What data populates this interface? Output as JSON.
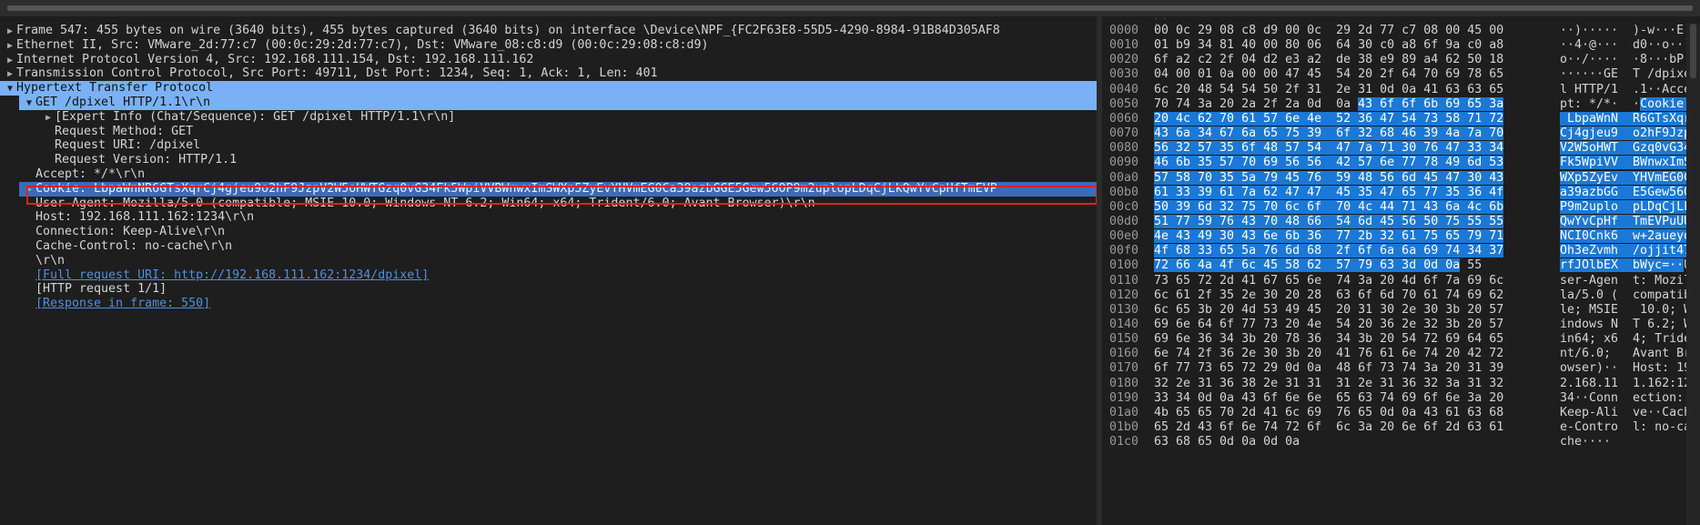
{
  "tree_rows": [
    {
      "text": "Frame 547: 455 bytes on wire (3640 bits), 455 bytes captured (3640 bits) on interface \\Device\\NPF_{FC2F63E8-55D5-4290-8984-91B84D305AF8",
      "indent": 0,
      "caret": "▶",
      "sel": "",
      "link": false
    },
    {
      "text": "Ethernet II, Src: VMware_2d:77:c7 (00:0c:29:2d:77:c7), Dst: VMware_08:c8:d9 (00:0c:29:08:c8:d9)",
      "indent": 0,
      "caret": "▶",
      "sel": "",
      "link": false
    },
    {
      "text": "Internet Protocol Version 4, Src: 192.168.111.154, Dst: 192.168.111.162",
      "indent": 0,
      "caret": "▶",
      "sel": "",
      "link": false
    },
    {
      "text": "Transmission Control Protocol, Src Port: 49711, Dst Port: 1234, Seq: 1, Ack: 1, Len: 401",
      "indent": 0,
      "caret": "▶",
      "sel": "",
      "link": false
    },
    {
      "text": "Hypertext Transfer Protocol",
      "indent": 0,
      "caret": "▼",
      "sel": "sel",
      "link": false
    },
    {
      "text": "GET /dpixel HTTP/1.1\\r\\n",
      "indent": 1,
      "caret": "▼",
      "sel": "sel",
      "link": false
    },
    {
      "text": "[Expert Info (Chat/Sequence): GET /dpixel HTTP/1.1\\r\\n]",
      "indent": 2,
      "caret": "▶",
      "sel": "",
      "link": false
    },
    {
      "text": "Request Method: GET",
      "indent": 2,
      "caret": "",
      "sel": "",
      "link": false
    },
    {
      "text": "Request URI: /dpixel",
      "indent": 2,
      "caret": "",
      "sel": "",
      "link": false
    },
    {
      "text": "Request Version: HTTP/1.1",
      "indent": 2,
      "caret": "",
      "sel": "",
      "link": false
    },
    {
      "text": "Accept: */*\\r\\n",
      "indent": 1,
      "caret": "",
      "sel": "",
      "link": false
    },
    {
      "text": "Cookie: LbpaWnNR6GTsXqrCj4gjeu9o2hF9JzpV2W5oHWTGzq0vG34Fk5WpiVVBWnwxImSWXp5ZyEvYHVmEG0Ca39azbGGE5Gew56OP9m2uplopLDqCjLkQwYvCpHfTmEVP",
      "indent": 1,
      "caret": "▶",
      "sel": "sel2",
      "link": false
    },
    {
      "text": "User-Agent: Mozilla/5.0 (compatible; MSIE 10.0; Windows NT 6.2; Win64; x64; Trident/6.0; Avant Browser)\\r\\n",
      "indent": 1,
      "caret": "",
      "sel": "",
      "link": false
    },
    {
      "text": "Host: 192.168.111.162:1234\\r\\n",
      "indent": 1,
      "caret": "",
      "sel": "",
      "link": false
    },
    {
      "text": "Connection: Keep-Alive\\r\\n",
      "indent": 1,
      "caret": "",
      "sel": "",
      "link": false
    },
    {
      "text": "Cache-Control: no-cache\\r\\n",
      "indent": 1,
      "caret": "",
      "sel": "",
      "link": false
    },
    {
      "text": "\\r\\n",
      "indent": 1,
      "caret": "",
      "sel": "",
      "link": false
    },
    {
      "text": "[Full request URI: http://192.168.111.162:1234/dpixel]",
      "indent": 1,
      "caret": "",
      "sel": "",
      "link": true
    },
    {
      "text": "[HTTP request 1/1]",
      "indent": 1,
      "caret": "",
      "sel": "",
      "link": false
    },
    {
      "text": "[Response in frame: 550]",
      "indent": 1,
      "caret": "",
      "sel": "",
      "link": true
    }
  ],
  "byte_rows": [
    {
      "off": "0000",
      "pre": "00 0c 29 08 c8 d9 00 0c  29 2d 77 c7 08 00 45 00",
      "hl": "",
      "post": "",
      "apre": "··)·····  )-w···E·",
      "ahl": "",
      "apost": ""
    },
    {
      "off": "0010",
      "pre": "01 b9 34 81 40 00 80 06  64 30 c0 a8 6f 9a c0 a8",
      "hl": "",
      "post": "",
      "apre": "··4·@···  d0··o···",
      "ahl": "",
      "apost": ""
    },
    {
      "off": "0020",
      "pre": "6f a2 c2 2f 04 d2 e3 a2  de 38 e9 89 a4 62 50 18",
      "hl": "",
      "post": "",
      "apre": "o··/····  ·8···bP·",
      "ahl": "",
      "apost": ""
    },
    {
      "off": "0030",
      "pre": "04 00 01 0a 00 00 47 45  54 20 2f 64 70 69 78 65",
      "hl": "",
      "post": "",
      "apre": "······GE  T /dpixe",
      "ahl": "",
      "apost": ""
    },
    {
      "off": "0040",
      "pre": "6c 20 48 54 54 50 2f 31  2e 31 0d 0a 41 63 63 65",
      "hl": "",
      "post": "",
      "apre": "l HTTP/1  .1··Acce",
      "ahl": "",
      "apost": ""
    },
    {
      "off": "0050",
      "pre": "70 74 3a 20 2a 2f 2a 0d  0a ",
      "hl": "43 6f 6f 6b 69 65 3a",
      "post": "",
      "apre": "pt: */*·  ·",
      "ahl": "Cookie:",
      "apost": ""
    },
    {
      "off": "0060",
      "pre": "",
      "hl": "20 4c 62 70 61 57 6e 4e  52 36 47 54 73 58 71 72",
      "post": "",
      "apre": "",
      "ahl": " LbpaWnN  R6GTsXqr",
      "apost": ""
    },
    {
      "off": "0070",
      "pre": "",
      "hl": "43 6a 34 67 6a 65 75 39  6f 32 68 46 39 4a 7a 70",
      "post": "",
      "apre": "",
      "ahl": "Cj4gjeu9  o2hF9Jzp",
      "apost": ""
    },
    {
      "off": "0080",
      "pre": "",
      "hl": "56 32 57 35 6f 48 57 54  47 7a 71 30 76 47 33 34",
      "post": "",
      "apre": "",
      "ahl": "V2W5oHWT  Gzq0vG34",
      "apost": ""
    },
    {
      "off": "0090",
      "pre": "",
      "hl": "46 6b 35 57 70 69 56 56  42 57 6e 77 78 49 6d 53",
      "post": "",
      "apre": "",
      "ahl": "Fk5WpiVV  BWnwxImS",
      "apost": ""
    },
    {
      "off": "00a0",
      "pre": "",
      "hl": "57 58 70 35 5a 79 45 76  59 48 56 6d 45 47 30 43",
      "post": "",
      "apre": "",
      "ahl": "WXp5ZyEv  YHVmEG0C",
      "apost": ""
    },
    {
      "off": "00b0",
      "pre": "",
      "hl": "61 33 39 61 7a 62 47 47  45 35 47 65 77 35 36 4f",
      "post": "",
      "apre": "",
      "ahl": "a39azbGG  E5Gew56O",
      "apost": ""
    },
    {
      "off": "00c0",
      "pre": "",
      "hl": "50 39 6d 32 75 70 6c 6f  70 4c 44 71 43 6a 4c 6b",
      "post": "",
      "apre": "",
      "ahl": "P9m2uplo  pLDqCjLk",
      "apost": ""
    },
    {
      "off": "00d0",
      "pre": "",
      "hl": "51 77 59 76 43 70 48 66  54 6d 45 56 50 75 55 55",
      "post": "",
      "apre": "",
      "ahl": "QwYvCpHf  TmEVPuUU",
      "apost": ""
    },
    {
      "off": "00e0",
      "pre": "",
      "hl": "4e 43 49 30 43 6e 6b 36  77 2b 32 61 75 65 79 71",
      "post": "",
      "apre": "",
      "ahl": "NCI0Cnk6  w+2aueyq",
      "apost": ""
    },
    {
      "off": "00f0",
      "pre": "",
      "hl": "4f 68 33 65 5a 76 6d 68  2f 6f 6a 6a 69 74 34 37",
      "post": "",
      "apre": "",
      "ahl": "Oh3eZvmh  /ojjit47",
      "apost": ""
    },
    {
      "off": "0100",
      "pre": "",
      "hl": "72 66 4a 4f 6c 45 58 62  57 79 63 3d 0d 0a",
      "post": " 55",
      "apre": "",
      "ahl": "rfJOlbEX  bWyc=··",
      "apost": "U"
    },
    {
      "off": "0110",
      "pre": "73 65 72 2d 41 67 65 6e  74 3a 20 4d 6f 7a 69 6c",
      "hl": "",
      "post": "",
      "apre": "ser-Agen  t: Mozil",
      "ahl": "",
      "apost": ""
    },
    {
      "off": "0120",
      "pre": "6c 61 2f 35 2e 30 20 28  63 6f 6d 70 61 74 69 62",
      "hl": "",
      "post": "",
      "apre": "la/5.0 (  compatib",
      "ahl": "",
      "apost": ""
    },
    {
      "off": "0130",
      "pre": "6c 65 3b 20 4d 53 49 45  20 31 30 2e 30 3b 20 57",
      "hl": "",
      "post": "",
      "apre": "le; MSIE   10.0; W",
      "ahl": "",
      "apost": ""
    },
    {
      "off": "0140",
      "pre": "69 6e 64 6f 77 73 20 4e  54 20 36 2e 32 3b 20 57",
      "hl": "",
      "post": "",
      "apre": "indows N  T 6.2; W",
      "ahl": "",
      "apost": ""
    },
    {
      "off": "0150",
      "pre": "69 6e 36 34 3b 20 78 36  34 3b 20 54 72 69 64 65",
      "hl": "",
      "post": "",
      "apre": "in64; x6  4; Tride",
      "ahl": "",
      "apost": ""
    },
    {
      "off": "0160",
      "pre": "6e 74 2f 36 2e 30 3b 20  41 76 61 6e 74 20 42 72",
      "hl": "",
      "post": "",
      "apre": "nt/6.0;   Avant Br",
      "ahl": "",
      "apost": ""
    },
    {
      "off": "0170",
      "pre": "6f 77 73 65 72 29 0d 0a  48 6f 73 74 3a 20 31 39",
      "hl": "",
      "post": "",
      "apre": "owser)··  Host: 19",
      "ahl": "",
      "apost": ""
    },
    {
      "off": "0180",
      "pre": "32 2e 31 36 38 2e 31 31  31 2e 31 36 32 3a 31 32",
      "hl": "",
      "post": "",
      "apre": "2.168.11  1.162:12",
      "ahl": "",
      "apost": ""
    },
    {
      "off": "0190",
      "pre": "33 34 0d 0a 43 6f 6e 6e  65 63 74 69 6f 6e 3a 20",
      "hl": "",
      "post": "",
      "apre": "34··Conn  ection: ",
      "ahl": "",
      "apost": ""
    },
    {
      "off": "01a0",
      "pre": "4b 65 65 70 2d 41 6c 69  76 65 0d 0a 43 61 63 68",
      "hl": "",
      "post": "",
      "apre": "Keep-Ali  ve··Cach",
      "ahl": "",
      "apost": ""
    },
    {
      "off": "01b0",
      "pre": "65 2d 43 6f 6e 74 72 6f  6c 3a 20 6e 6f 2d 63 61",
      "hl": "",
      "post": "",
      "apre": "e-Contro  l: no-ca",
      "ahl": "",
      "apost": ""
    },
    {
      "off": "01c0",
      "pre": "63 68 65 0d 0a 0d 0a",
      "hl": "",
      "post": "",
      "apre": "che····",
      "ahl": "",
      "apost": ""
    }
  ]
}
